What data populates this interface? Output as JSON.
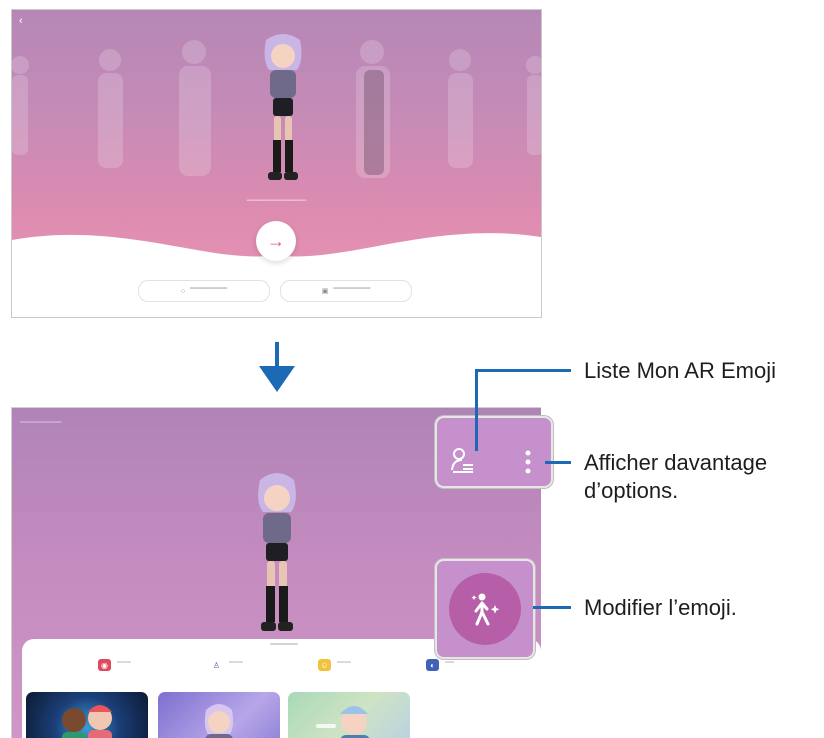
{
  "screen_top": {
    "back_glyph": "‹",
    "next_arrow": "→"
  },
  "down_arrow_color": "#1b6ab3",
  "callouts": {
    "list": "Liste Mon AR Emoji",
    "more_line1": "Afficher davantage",
    "more_line2": "d’options.",
    "edit": "Modifier l’emoji."
  },
  "icons": {
    "list": "avatar-list-icon",
    "more": "more-options-icon",
    "edit": "edit-emoji-icon",
    "arrow": "arrow-right-icon"
  },
  "colors": {
    "accent": "#1b6ab3",
    "callout_bg": "#c690cc",
    "edit_circle": "#b65fa8",
    "pink": "#e05a7a"
  }
}
